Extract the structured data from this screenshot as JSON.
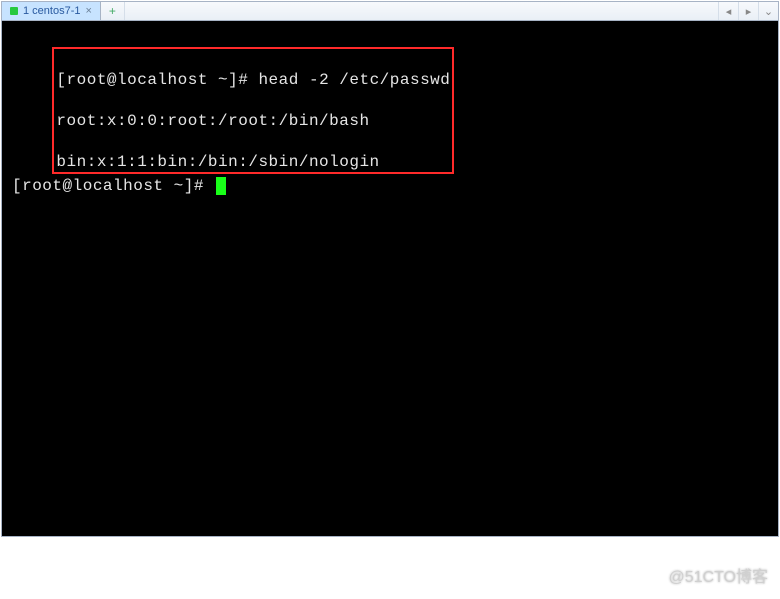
{
  "tabbar": {
    "active_tab_label": "1 centos7-1",
    "newtab_glyph": "+",
    "nav_prev_glyph": "◂",
    "nav_next_glyph": "▸",
    "nav_expand_glyph": "⌄"
  },
  "terminal": {
    "prompt": "[root@localhost ~]#",
    "command": "head -2 /etc/passwd",
    "output": [
      "root:x:0:0:root:/root:/bin/bash",
      "bin:x:1:1:bin:/bin:/sbin/nologin"
    ]
  },
  "watermark": "@51CTO博客"
}
